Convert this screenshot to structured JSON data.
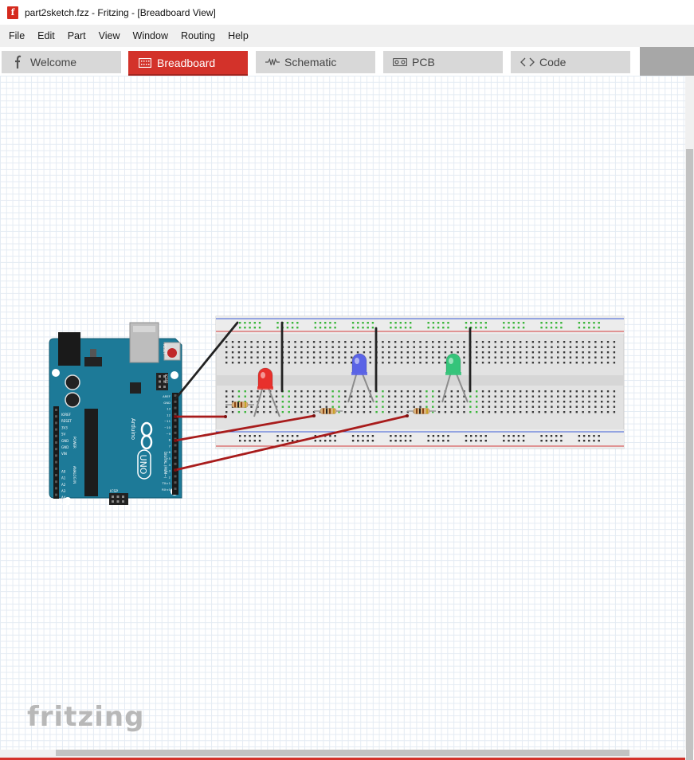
{
  "window": {
    "title": "part2sketch.fzz - Fritzing - [Breadboard View]",
    "app_icon": "fritzing-app-icon"
  },
  "menu": [
    "File",
    "Edit",
    "Part",
    "View",
    "Window",
    "Routing",
    "Help"
  ],
  "tabs": [
    {
      "label": "Welcome",
      "icon": "fritzing-f-icon",
      "active": false
    },
    {
      "label": "Breadboard",
      "icon": "breadboard-icon",
      "active": true
    },
    {
      "label": "Schematic",
      "icon": "resistor-zigzag-icon",
      "active": false
    },
    {
      "label": "PCB",
      "icon": "pcb-icon",
      "active": false
    },
    {
      "label": "Code",
      "icon": "code-brackets-icon",
      "active": false
    }
  ],
  "canvas": {
    "arduino": {
      "board_label": "UNO",
      "brand_label": "Arduino",
      "reset_label": "RESET",
      "icsp_label": "ICSP",
      "icsp2_label": "ICSP2",
      "power_label": "POWER",
      "analog_label": "ANALOG IN",
      "digital_label": "DIGITAL (PWM~)",
      "left_pins": [
        "IOREF",
        "RESET",
        "3V3",
        "5V",
        "GND",
        "GND",
        "VIN",
        "A0",
        "A1",
        "A2",
        "A3",
        "A4",
        "A5"
      ],
      "right_pins": [
        "AREF",
        "GND",
        "13",
        "12",
        "~11",
        "~10",
        "~9",
        "8",
        "7",
        "~6",
        "~5",
        "4",
        "~3",
        "2",
        "TX>1",
        "RX<0"
      ],
      "colors": {
        "board": "#1d7a98",
        "headers": "#222222",
        "reset_button": "#c0282a"
      }
    },
    "leds": [
      {
        "color_name": "red",
        "color": "#e8302c"
      },
      {
        "color_name": "blue",
        "color": "#5a63e6"
      },
      {
        "color_name": "green",
        "color": "#35c47a"
      }
    ],
    "wires": {
      "signal_color": "#a81c1c",
      "ground_color": "#222222"
    },
    "watermark": "fritzing"
  }
}
